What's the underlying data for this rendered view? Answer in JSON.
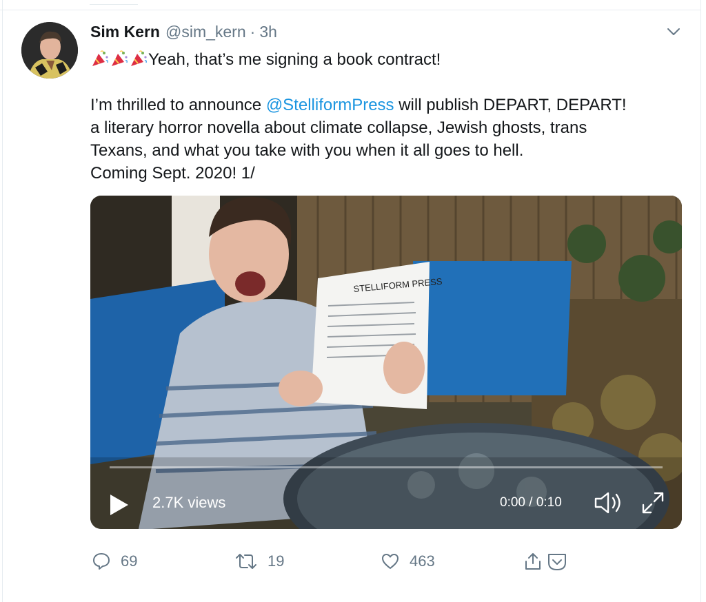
{
  "tweet": {
    "author_name": "Sim Kern",
    "handle": "@sim_kern",
    "separator": "·",
    "time": "3h",
    "line1": "Yeah, that’s me signing a book contract!",
    "para2_before_mention": "I’m thrilled to announce ",
    "mention": "@StelliformPress",
    "para2_after_mention": " will publish DEPART, DEPART!",
    "line3": "a literary horror novella about climate collapse, Jewish ghosts, trans",
    "line4": "Texans, and what you take with you when it all goes to hell.",
    "line5": "Coming Sept. 2020!   1/"
  },
  "video": {
    "views": "2.7K views",
    "timecode": "0:00 / 0:10",
    "paper_heading": "STELLIFORM PRESS",
    "progress": 0
  },
  "actions": {
    "replies": "69",
    "retweets": "19",
    "likes": "463"
  },
  "colors": {
    "mention": "#1b95e0",
    "muted": "#657786",
    "text": "#14171a"
  },
  "icons": {
    "emoji": "party-popper",
    "caret": "chevron-down",
    "reply": "speech-bubble",
    "retweet": "retweet-arrows",
    "like": "heart",
    "share": "share-arrow",
    "save": "bookmark-chevron",
    "play": "play-triangle",
    "volume": "speaker",
    "expand": "expand-arrows"
  }
}
